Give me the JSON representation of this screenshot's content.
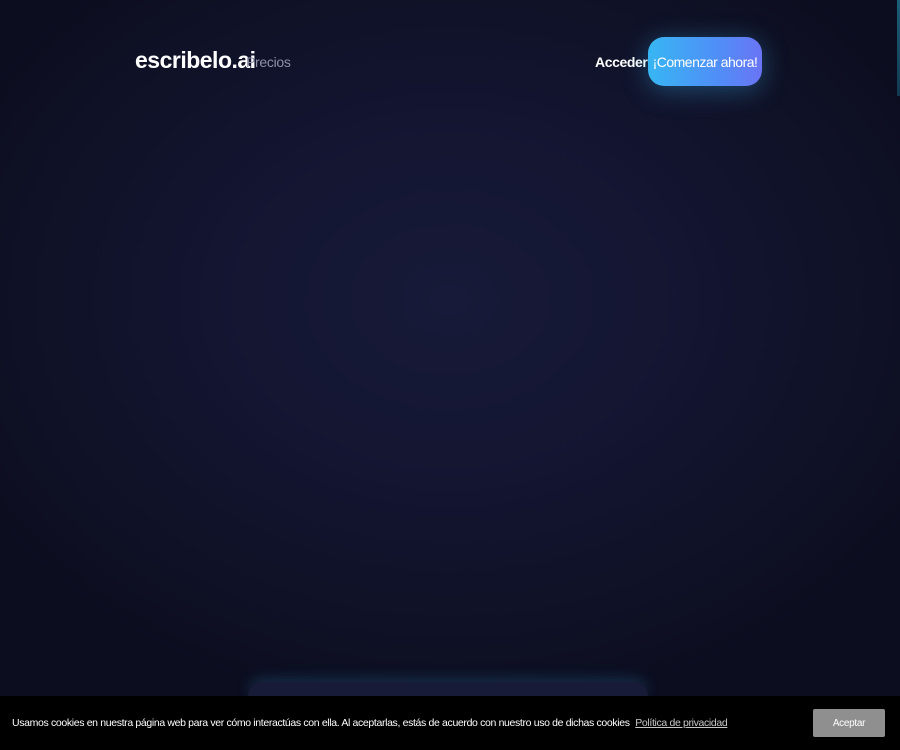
{
  "header": {
    "logo": "escribelo.ai",
    "nav": [
      {
        "label": "Precios"
      }
    ],
    "login_label": "Acceder",
    "cta_label": "¡Comenzar ahora!"
  },
  "cookie_banner": {
    "message": "Usamos cookies en nuestra página web para ver cómo interactúas con ella. Al aceptarlas, estás de acuerdo con nuestro uso de dichas cookies",
    "privacy_link": "Política de privacidad",
    "accept_label": "Aceptar"
  },
  "colors": {
    "background": "#11132a",
    "accent_start": "#38b6f3",
    "accent_end": "#6a74f5",
    "cookie_bar": "#000000",
    "accept_button": "#8f8f8f"
  }
}
